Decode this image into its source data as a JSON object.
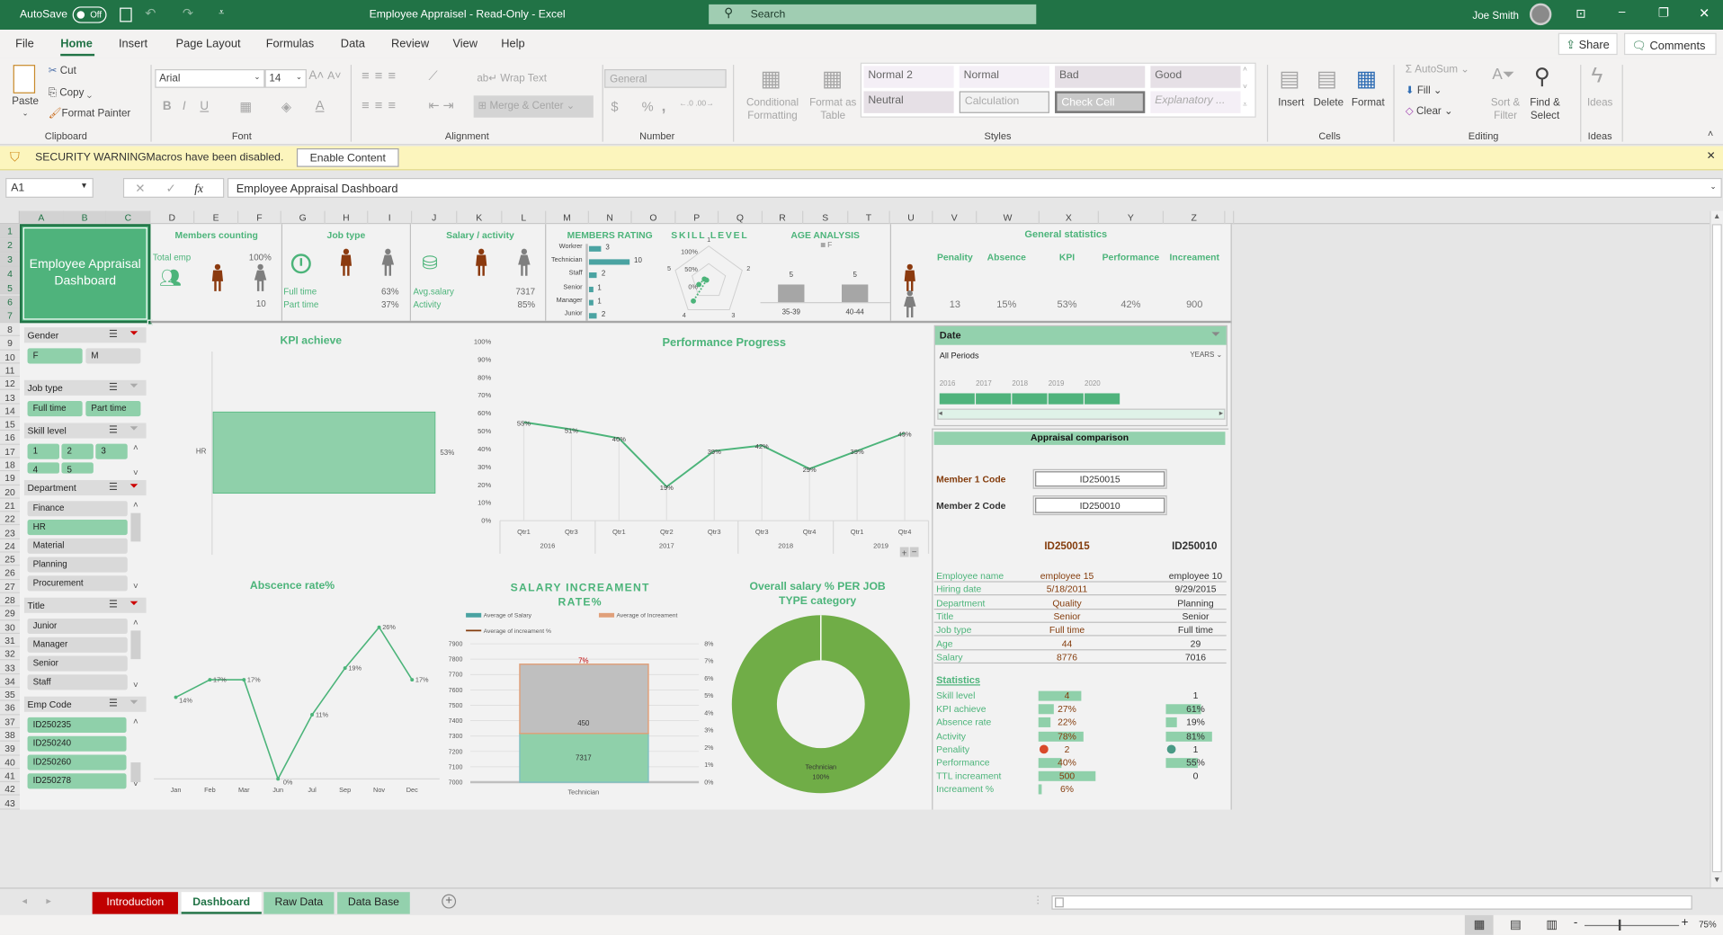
{
  "titlebar": {
    "autosave": "AutoSave",
    "autosave_state": "Off",
    "title": "Employee Appraisel  -  Read-Only  -  Excel",
    "search": "Search",
    "user": "Joe Smith"
  },
  "menu": {
    "tabs": [
      "File",
      "Home",
      "Insert",
      "Page Layout",
      "Formulas",
      "Data",
      "Review",
      "View",
      "Help"
    ],
    "active": "Home",
    "share": "Share",
    "comments": "Comments"
  },
  "ribbon": {
    "clipboard": {
      "paste": "Paste",
      "cut": "Cut",
      "copy": "Copy",
      "format_painter": "Format Painter",
      "label": "Clipboard"
    },
    "font": {
      "name": "Arial",
      "size": "14",
      "bold": "B",
      "italic": "I",
      "underline": "U",
      "label": "Font"
    },
    "alignment": {
      "wrap": "Wrap Text",
      "merge": "Merge & Center",
      "label": "Alignment"
    },
    "number": {
      "format": "General",
      "currency": "$",
      "percent": "%",
      "comma": ",",
      "label": "Number"
    },
    "styles": {
      "conditional_1": "Conditional",
      "conditional_2": "Formatting",
      "table_1": "Format as",
      "table_2": "Table",
      "cells": [
        "Normal 2",
        "Normal",
        "Bad",
        "Good",
        "Neutral",
        "Calculation",
        "Check Cell",
        "Explanatory ..."
      ],
      "label": "Styles"
    },
    "cells": {
      "insert": "Insert",
      "delete": "Delete",
      "format": "Format",
      "label": "Cells"
    },
    "editing": {
      "autosum": "AutoSum",
      "fill": "Fill",
      "clear": "Clear",
      "sort_1": "Sort &",
      "sort_2": "Filter",
      "find_1": "Find &",
      "find_2": "Select",
      "label": "Editing"
    },
    "ideas": {
      "ideas": "Ideas",
      "label": "Ideas"
    }
  },
  "security": {
    "title": "SECURITY WARNING",
    "message": "Macros have been disabled.",
    "button": "Enable Content"
  },
  "formula": {
    "namebox": "A1",
    "fx": "fx",
    "content": "Employee Appraisal Dashboard"
  },
  "columns": [
    "A",
    "B",
    "C",
    "D",
    "E",
    "F",
    "G",
    "H",
    "I",
    "J",
    "K",
    "L",
    "M",
    "N",
    "O",
    "P",
    "Q",
    "R",
    "S",
    "T",
    "U",
    "V",
    "W",
    "X",
    "Y",
    "Z"
  ],
  "rows": [
    "1",
    "2",
    "3",
    "4",
    "5",
    "6",
    "7",
    "8",
    "9",
    "10",
    "11",
    "12",
    "13",
    "14",
    "15",
    "16",
    "17",
    "18",
    "19",
    "20",
    "21",
    "22",
    "23",
    "24",
    "25",
    "26",
    "27",
    "28",
    "29",
    "30",
    "31",
    "32",
    "33",
    "34",
    "35",
    "36",
    "37",
    "38",
    "39",
    "40",
    "41",
    "42",
    "43"
  ],
  "dashboard": {
    "title": "Employee Appraisal Dashboard",
    "members": {
      "title": "Members counting",
      "label": "Total emp",
      "pct": "100%",
      "count": "10"
    },
    "jobtype": {
      "title": "Job type",
      "full": "Full time",
      "full_pct": "63%",
      "part": "Part time",
      "part_pct": "37%"
    },
    "salary": {
      "title": "Salary / activity",
      "avg_label": "Avg.salary",
      "avg": "7317",
      "activity_label": "Activity",
      "activity": "85%"
    },
    "rating": {
      "title": "MEMBERS RATING",
      "items": [
        {
          "label": "Workrer",
          "value": 3
        },
        {
          "label": "Technician",
          "value": 10
        },
        {
          "label": "Staff",
          "value": 2
        },
        {
          "label": "Senior",
          "value": 1
        },
        {
          "label": "Manager",
          "value": 1
        },
        {
          "label": "Junior",
          "value": 2
        }
      ],
      "color": "#4aa3a2"
    },
    "skill": {
      "title": "SKILL LEVEL",
      "ticks": [
        "100%",
        "50%",
        "0%"
      ],
      "axes": [
        "1",
        "2",
        "3",
        "4",
        "5"
      ]
    },
    "age": {
      "title": "AGE ANALYSIS",
      "legend": "F",
      "categories": [
        "35-39",
        "40-44"
      ],
      "values": [
        5,
        5
      ]
    },
    "general": {
      "title": "General statistics",
      "headers": [
        "Penality",
        "Absence",
        "KPI",
        "Performance",
        "Increament"
      ],
      "values": [
        "13",
        "15%",
        "53%",
        "42%",
        "900"
      ]
    }
  },
  "slicers": [
    {
      "title": "Gender",
      "items": [
        {
          "label": "F",
          "on": true
        },
        {
          "label": "M",
          "on": false
        }
      ]
    },
    {
      "title": "Job type",
      "items": [
        {
          "label": "Full time",
          "on": true
        },
        {
          "label": "Part time",
          "on": true
        }
      ]
    },
    {
      "title": "Skill level",
      "items": [
        {
          "label": "1",
          "on": true
        },
        {
          "label": "2",
          "on": true
        },
        {
          "label": "3",
          "on": true
        },
        {
          "label": "4",
          "on": true
        },
        {
          "label": "5",
          "on": true
        }
      ]
    },
    {
      "title": "Department",
      "items": [
        {
          "label": "Finance",
          "on": false
        },
        {
          "label": "HR",
          "on": true
        },
        {
          "label": "Material",
          "on": false
        },
        {
          "label": "Planning",
          "on": false
        },
        {
          "label": "Procurement",
          "on": false
        }
      ]
    },
    {
      "title": "Title",
      "items": [
        {
          "label": "Junior",
          "on": false
        },
        {
          "label": "Manager",
          "on": false
        },
        {
          "label": "Senior",
          "on": false
        },
        {
          "label": "Staff",
          "on": false
        }
      ]
    },
    {
      "title": "Emp Code",
      "items": [
        {
          "label": "ID250235",
          "on": true
        },
        {
          "label": "ID250240",
          "on": true
        },
        {
          "label": "ID250260",
          "on": true
        },
        {
          "label": "ID250278",
          "on": true
        }
      ]
    }
  ],
  "chart_data": [
    {
      "type": "bar",
      "title": "KPI achieve",
      "categories": [
        "HR"
      ],
      "values": [
        0.53
      ],
      "data_labels": [
        "53%"
      ],
      "orientation": "horizontal"
    },
    {
      "type": "line",
      "title": "Performance Progress",
      "categories": [
        "Qtr1",
        "Qtr3",
        "Qtr1",
        "Qtr2",
        "Qtr3",
        "Qtr3",
        "Qtr4",
        "Qtr1",
        "Qtr4"
      ],
      "groups": [
        {
          "label": "2016",
          "span": 2
        },
        {
          "label": "2017",
          "span": 3
        },
        {
          "label": "2018",
          "span": 2
        },
        {
          "label": "2019",
          "span": 2
        }
      ],
      "values": [
        0.55,
        0.51,
        0.46,
        0.19,
        0.39,
        0.42,
        0.29,
        0.39,
        0.49
      ],
      "yticks": [
        "0%",
        "10%",
        "20%",
        "30%",
        "40%",
        "50%",
        "60%",
        "70%",
        "80%",
        "90%",
        "100%"
      ],
      "ylim": [
        0,
        1
      ],
      "color": "#4cb47a"
    },
    {
      "type": "line",
      "title": "Abscence rate%",
      "categories": [
        "Jan",
        "Feb",
        "Mar",
        "Jun",
        "Jul",
        "Sep",
        "Nov",
        "Dec"
      ],
      "values": [
        0.14,
        0.17,
        0.17,
        0,
        0.11,
        0.19,
        0.26,
        0.17
      ],
      "color": "#4cb47a"
    },
    {
      "type": "bar",
      "stacked": true,
      "title_1": "SALARY INCREAMENT",
      "title_2": "RATE%",
      "categories": [
        "Technician"
      ],
      "series": [
        {
          "name": "Average of Salary",
          "values": [
            7317
          ],
          "color": "#8fd0aa"
        },
        {
          "name": "Average of Increament",
          "values": [
            450
          ],
          "color": "#bfbfbf"
        },
        {
          "name": "Average of increament %",
          "values": [
            0.07
          ],
          "axis": "right",
          "label": "7%"
        }
      ],
      "ylim": [
        7000,
        7900
      ],
      "yticks": [
        "7000",
        "7100",
        "7200",
        "7300",
        "7400",
        "7500",
        "7600",
        "7700",
        "7800",
        "7900"
      ],
      "y2lim": [
        0,
        0.08
      ],
      "y2ticks": [
        "0%",
        "1%",
        "2%",
        "3%",
        "4%",
        "5%",
        "6%",
        "7%",
        "8%"
      ]
    },
    {
      "type": "pie",
      "donut": true,
      "title_1": "Overall salary % PER JOB",
      "title_2": "TYPE category",
      "categories": [
        "Technician"
      ],
      "values": [
        1
      ],
      "labels": [
        "100%"
      ],
      "color": "#70ad47"
    }
  ],
  "date_slicer": {
    "title": "Date",
    "period": "All Periods",
    "level": "YEARS",
    "years": [
      "2016",
      "2017",
      "2018",
      "2019",
      "2020"
    ]
  },
  "appraisal": {
    "title": "Appraisal comparison",
    "member1_label": "Member 1 Code",
    "member1": "ID250015",
    "member2_label": "Member 2 Code",
    "member2": "ID250010",
    "head1": "ID250015",
    "head2": "ID250010",
    "rows": [
      [
        "Employee name",
        "employee 15",
        "employee 10"
      ],
      [
        "Hiring date",
        "5/18/2011",
        "9/29/2015"
      ],
      [
        "Department",
        "Quality",
        "Planning"
      ],
      [
        "Title",
        "Senior",
        "Senior"
      ],
      [
        "Job type",
        "Full time",
        "Full time"
      ],
      [
        "Age",
        "44",
        "29"
      ],
      [
        "Salary",
        "8776",
        "7016"
      ]
    ],
    "stats_title": "Statistics",
    "stats": [
      {
        "label": "Skill level",
        "v1": "4",
        "f1": 0.75,
        "v2": "1",
        "f2": 0
      },
      {
        "label": "KPI achieve",
        "v1": "27%",
        "f1": 0.27,
        "v2": "61%",
        "f2": 0.61
      },
      {
        "label": "Absence rate",
        "v1": "22%",
        "f1": 0.22,
        "v2": "19%",
        "f2": 0.19
      },
      {
        "label": "Activity",
        "v1": "78%",
        "f1": 0.78,
        "v2": "81%",
        "f2": 0.81
      },
      {
        "label": "Penality",
        "v1": "2",
        "dot1": "#d9492a",
        "v2": "1",
        "dot2": "#4a9a86"
      },
      {
        "label": "Performance",
        "v1": "40%",
        "f1": 0.4,
        "v2": "55%",
        "f2": 0.55
      },
      {
        "label": "TTL increament",
        "v1": "500",
        "f1": 1.0,
        "v2": "0",
        "f2": 0
      },
      {
        "label": "Increament %",
        "v1": "6%",
        "f1": 0.06
      }
    ]
  },
  "sheets": [
    {
      "label": "Introduction",
      "style": "red"
    },
    {
      "label": "Dashboard",
      "style": "active"
    },
    {
      "label": "Raw Data",
      "style": "green"
    },
    {
      "label": "Data Base",
      "style": "green"
    }
  ],
  "status": {
    "zoom": "75%"
  },
  "colors": {
    "accent": "#4cb47a",
    "selected": "#8fd0aa",
    "excel_green": "#217346",
    "male": "#8b3a0f",
    "female": "#7f7f7f"
  }
}
